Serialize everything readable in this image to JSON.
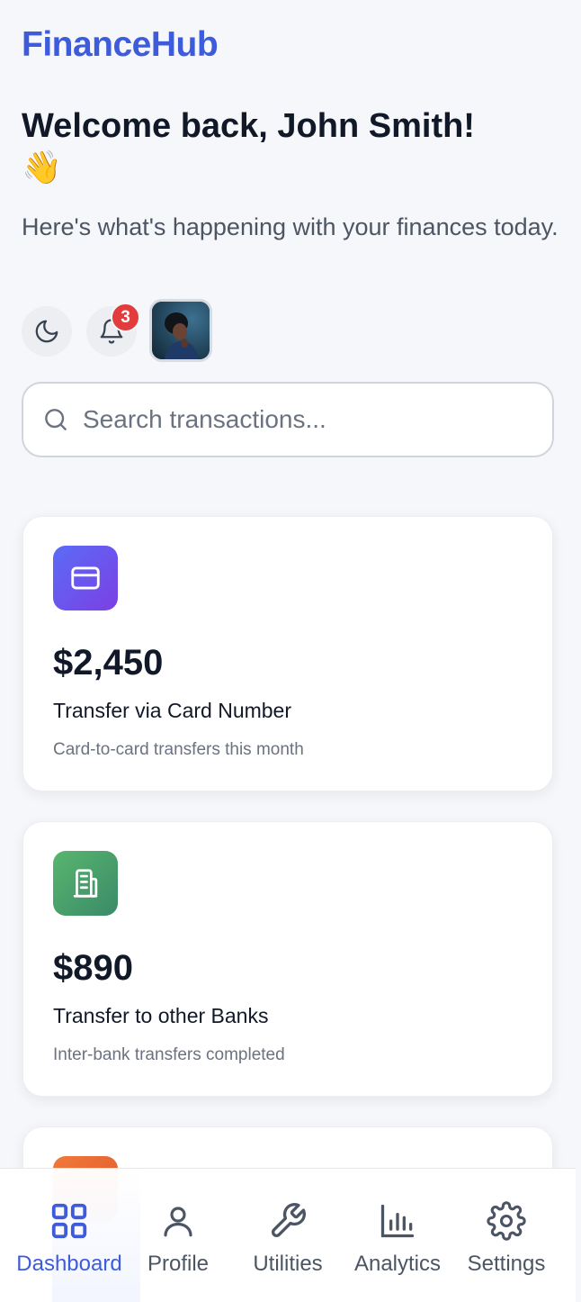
{
  "app": {
    "brand": "FinanceHub"
  },
  "header": {
    "welcome": "Welcome back, John Smith!",
    "wave": "👋",
    "subtitle": "Here's what's happening with your finances today."
  },
  "toolbar": {
    "theme_icon": "moon-icon",
    "notifications_icon": "bell-icon",
    "notification_count": "3"
  },
  "search": {
    "placeholder": "Search transactions...",
    "value": ""
  },
  "cards": [
    {
      "icon": "credit-card-icon",
      "amount": "$2,450",
      "title": "Transfer via Card Number",
      "description": "Card-to-card transfers this month"
    },
    {
      "icon": "bank-building-icon",
      "amount": "$890",
      "title": "Transfer to other Banks",
      "description": "Inter-bank transfers completed"
    },
    {
      "icon": "orange-card-icon"
    }
  ],
  "nav": {
    "items": [
      {
        "label": "Dashboard",
        "icon": "dashboard-icon",
        "active": true
      },
      {
        "label": "Profile",
        "icon": "user-icon",
        "active": false
      },
      {
        "label": "Utilities",
        "icon": "wrench-icon",
        "active": false
      },
      {
        "label": "Analytics",
        "icon": "bar-chart-icon",
        "active": false
      },
      {
        "label": "Settings",
        "icon": "gear-icon",
        "active": false
      }
    ]
  },
  "colors": {
    "brand": "#3d5bdb",
    "badge": "#e23c3c",
    "background": "#f6f7fa",
    "card_purple": "#6a55ee",
    "card_green": "#4ea16b",
    "card_orange": "#e9652f"
  }
}
